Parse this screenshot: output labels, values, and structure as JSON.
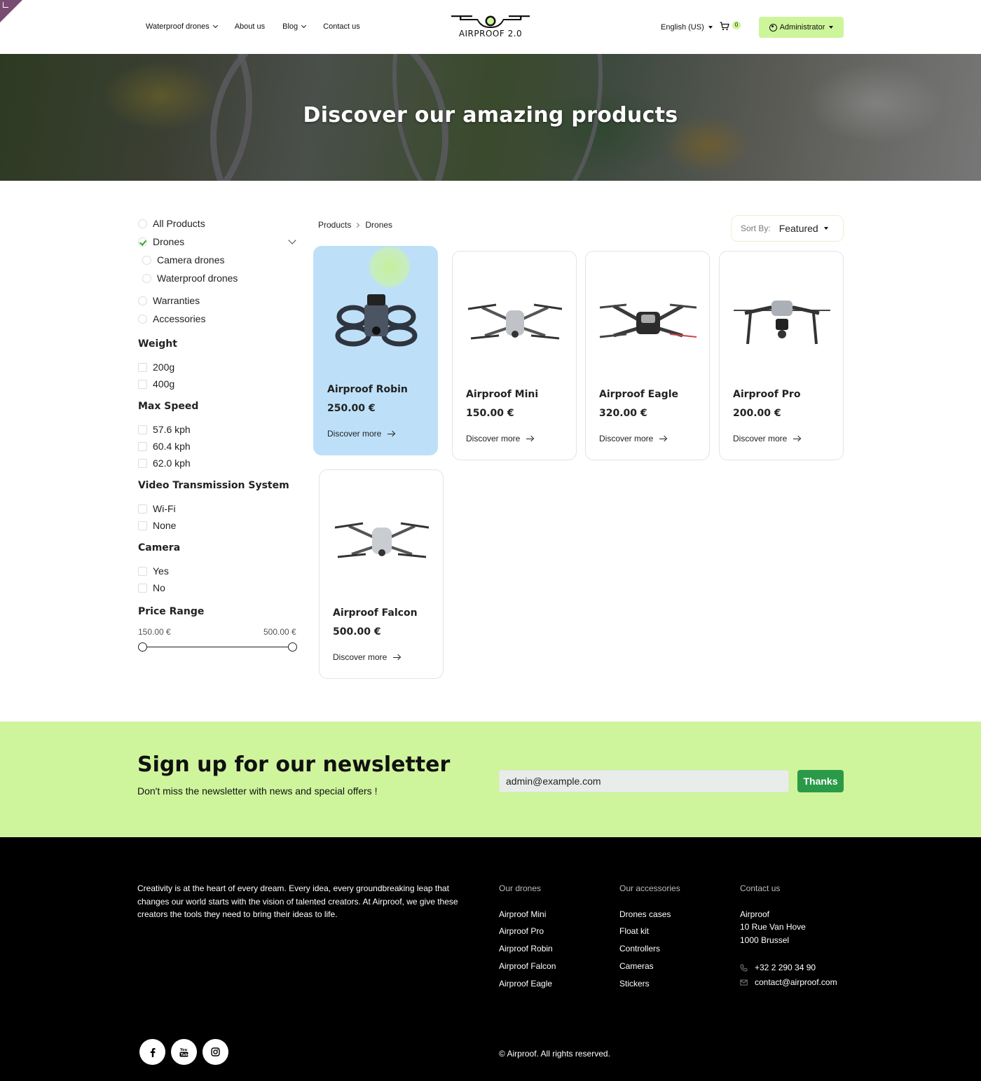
{
  "header": {
    "nav": [
      "Waterproof drones",
      "About us",
      "Blog",
      "Contact us"
    ],
    "logo_text": "AIRPROOF 2.0",
    "language": "English (US)",
    "cart_count": "0",
    "account_label": "Administrator",
    "brand_color": "#cdf59a"
  },
  "hero": {
    "title": "Discover our amazing products"
  },
  "sidebar": {
    "categories": {
      "all": "All Products",
      "drones": "Drones",
      "camera_drones": "Camera drones",
      "waterproof_drones": "Waterproof drones",
      "warranties": "Warranties",
      "accessories": "Accessories"
    },
    "weight": {
      "title": "Weight",
      "options": [
        "200g",
        "400g"
      ]
    },
    "max_speed": {
      "title": "Max Speed",
      "options": [
        "57.6 kph",
        "60.4 kph",
        "62.0 kph"
      ]
    },
    "video": {
      "title": "Video Transmission System",
      "options": [
        "Wi-Fi",
        "None"
      ]
    },
    "camera": {
      "title": "Camera",
      "options": [
        "Yes",
        "No"
      ]
    },
    "price": {
      "title": "Price Range",
      "min": "150.00 €",
      "max": "500.00 €"
    }
  },
  "main": {
    "breadcrumb": [
      "Products",
      "Drones"
    ],
    "sort_label": "Sort By:",
    "sort_value": "Featured",
    "products": [
      {
        "name": "Airproof Robin",
        "price": "250.00 €",
        "cta": "Discover more"
      },
      {
        "name": "Airproof Mini",
        "price": "150.00 €",
        "cta": "Discover more"
      },
      {
        "name": "Airproof Eagle",
        "price": "320.00 €",
        "cta": "Discover more"
      },
      {
        "name": "Airproof Pro",
        "price": "200.00 €",
        "cta": "Discover more"
      },
      {
        "name": "Airproof Falcon",
        "price": "500.00 €",
        "cta": "Discover more"
      }
    ]
  },
  "newsletter": {
    "title": "Sign up for our newsletter",
    "subtitle": "Don't miss the newsletter with news and special offers !",
    "email_value": "admin@example.com",
    "button": "Thanks"
  },
  "footer": {
    "about": "Creativity is at the heart of every dream. Every idea, every groundbreaking leap that changes our world starts with the vision of talented creators. At Airproof, we give these creators the tools they need to bring their ideas to life.",
    "drones_title": "Our drones",
    "drones": [
      "Airproof Mini",
      "Airproof Pro",
      "Airproof Robin",
      "Airproof Falcon",
      "Airproof Eagle"
    ],
    "accessories_title": "Our accessories",
    "accessories": [
      "Drones cases",
      "Float kit",
      "Controllers",
      "Cameras",
      "Stickers"
    ],
    "contact_title": "Contact us",
    "address": [
      "Airproof",
      "10 Rue Van Hove",
      "1000 Brussel"
    ],
    "phone": "+32 2 290 34 90",
    "email": "contact@airproof.com",
    "copyright": "© Airproof. All rights reserved.",
    "social_icons": [
      "facebook-icon",
      "youtube-icon",
      "instagram-icon"
    ]
  }
}
